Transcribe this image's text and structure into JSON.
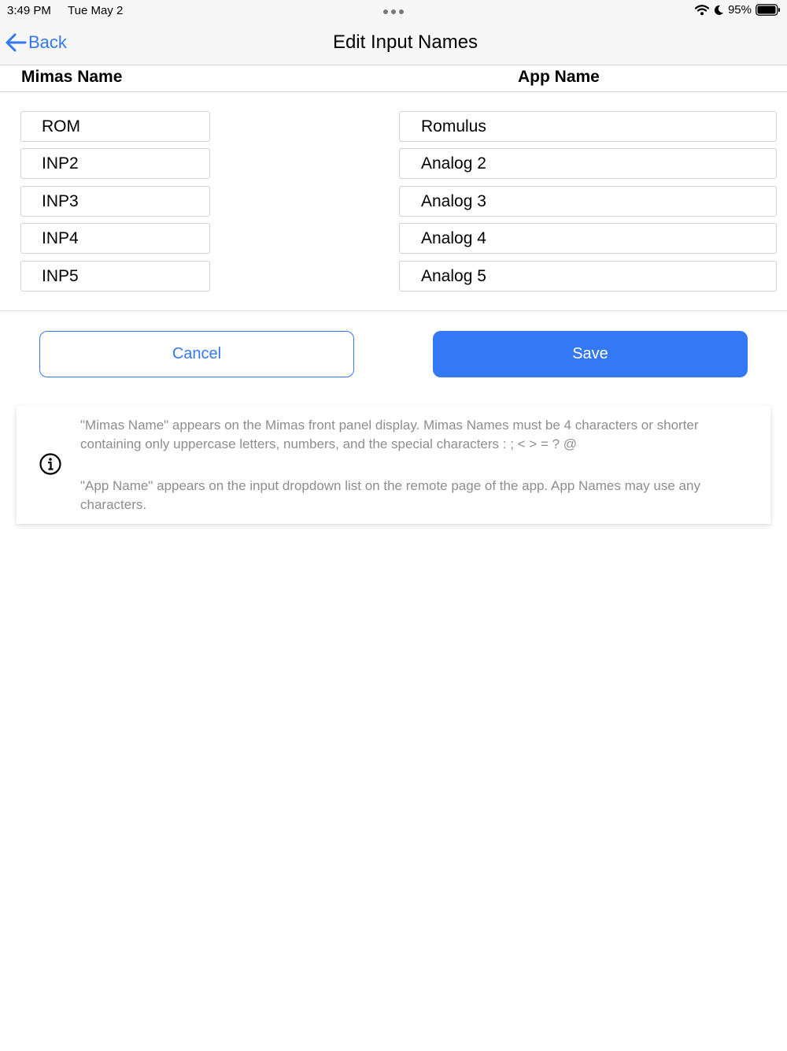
{
  "status_bar": {
    "time": "3:49 PM",
    "date": "Tue May 2",
    "battery_percent": "95%",
    "icons": [
      "wifi-icon",
      "moon-icon",
      "battery-icon"
    ]
  },
  "nav": {
    "back_label": "Back",
    "title": "Edit Input Names"
  },
  "columns": {
    "left_header": "Mimas Name",
    "right_header": "App Name"
  },
  "rows": [
    {
      "mimas_name": "ROM",
      "app_name": "Romulus"
    },
    {
      "mimas_name": "INP2",
      "app_name": "Analog 2"
    },
    {
      "mimas_name": "INP3",
      "app_name": "Analog 3"
    },
    {
      "mimas_name": "INP4",
      "app_name": "Analog 4"
    },
    {
      "mimas_name": "INP5",
      "app_name": "Analog 5"
    }
  ],
  "buttons": {
    "cancel_label": "Cancel",
    "save_label": "Save"
  },
  "info": {
    "paragraph1": "\"Mimas Name\" appears on the Mimas front panel display. Mimas Names must be 4 characters or shorter containing only uppercase letters, numbers, and the special characters : ; < > = ? @",
    "paragraph2": "\"App Name\" appears on the input dropdown list on the remote page of the app. App Names may use any characters."
  },
  "colors": {
    "accent": "#3478f6",
    "info_text": "#8e8e8e"
  }
}
